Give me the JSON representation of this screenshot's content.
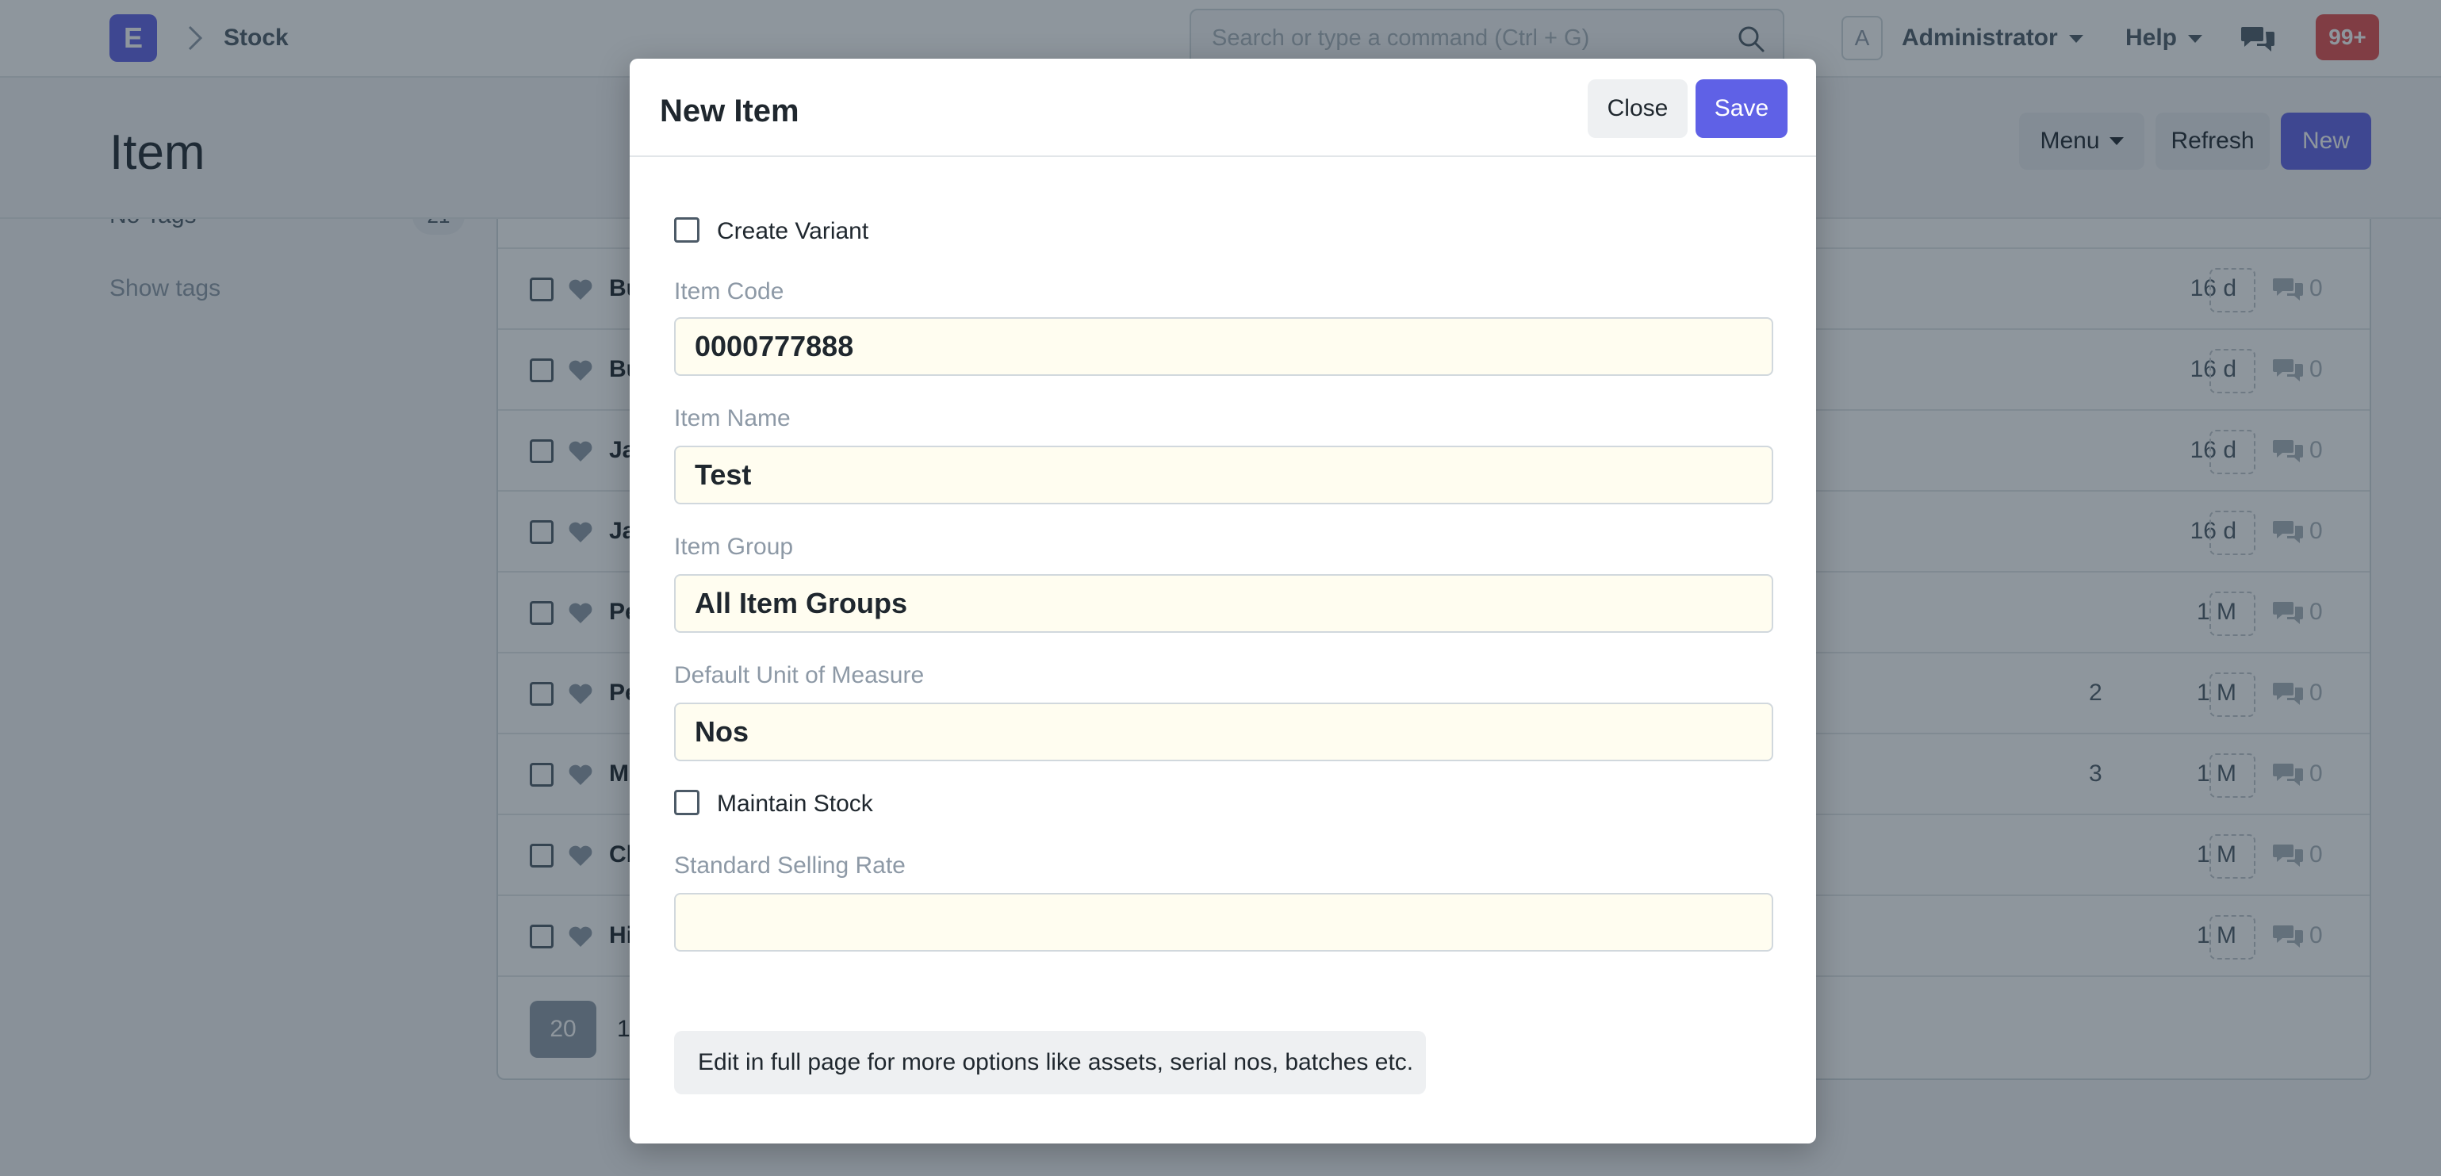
{
  "navbar": {
    "logo_letter": "E",
    "breadcrumb": "Stock",
    "search_placeholder": "Search or type a command (Ctrl + G)",
    "avatar_letter": "A",
    "user": "Administrator",
    "help": "Help",
    "notifications": "99+"
  },
  "page": {
    "title": "Item",
    "menu": "Menu",
    "refresh": "Refresh",
    "new": "New"
  },
  "sidebar": {
    "tag": "No Tags",
    "tag_count": "21",
    "show_tags": "Show tags"
  },
  "list": {
    "rows": [
      {
        "name": "Bu",
        "extra": "",
        "time": "16 d",
        "comments": "0"
      },
      {
        "name": "Bu",
        "extra": "",
        "time": "16 d",
        "comments": "0"
      },
      {
        "name": "Ja",
        "extra": "",
        "time": "16 d",
        "comments": "0"
      },
      {
        "name": "Ja",
        "extra": "",
        "time": "16 d",
        "comments": "0"
      },
      {
        "name": "Pe",
        "extra": "",
        "time": "1 M",
        "comments": "0"
      },
      {
        "name": "Pe",
        "extra": "2",
        "time": "1 M",
        "comments": "0"
      },
      {
        "name": "M",
        "extra": "3",
        "time": "1 M",
        "comments": "0"
      },
      {
        "name": "Cl",
        "extra": "",
        "time": "1 M",
        "comments": "0"
      },
      {
        "name": "Hi",
        "extra": "",
        "time": "1 M",
        "comments": "0"
      }
    ],
    "page_size": "20",
    "page_next": "1"
  },
  "modal": {
    "title": "New Item",
    "close": "Close",
    "save": "Save",
    "create_variant": "Create Variant",
    "item_code_label": "Item Code",
    "item_code": "0000777888",
    "item_name_label": "Item Name",
    "item_name": "Test",
    "item_group_label": "Item Group",
    "item_group": "All Item Groups",
    "uom_label": "Default Unit of Measure",
    "uom": "Nos",
    "maintain_stock": "Maintain Stock",
    "selling_rate_label": "Standard Selling Rate",
    "selling_rate": "",
    "help_text": "Edit in full page for more options like assets, serial nos, batches etc."
  },
  "colors": {
    "primary": "#5f61e6",
    "badge": "#e24c4c",
    "input_bg": "#fffdf0"
  }
}
